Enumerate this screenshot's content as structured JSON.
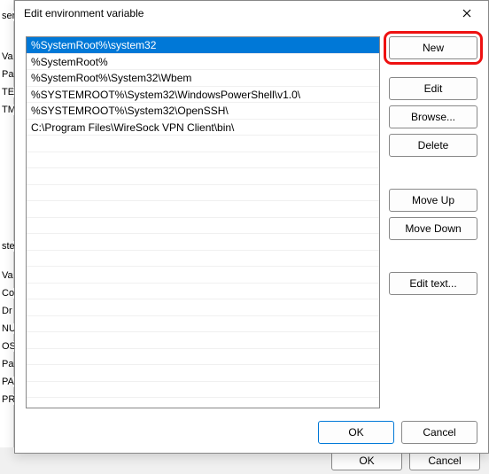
{
  "dialog": {
    "title": "Edit environment variable",
    "close_icon": "close-icon"
  },
  "paths": [
    "%SystemRoot%\\system32",
    "%SystemRoot%",
    "%SystemRoot%\\System32\\Wbem",
    "%SYSTEMROOT%\\System32\\WindowsPowerShell\\v1.0\\",
    "%SYSTEMROOT%\\System32\\OpenSSH\\",
    "C:\\Program Files\\WireSock VPN Client\\bin\\"
  ],
  "selected_index": 0,
  "buttons": {
    "new": "New",
    "edit": "Edit",
    "browse": "Browse...",
    "delete": "Delete",
    "move_up": "Move Up",
    "move_down": "Move Down",
    "edit_text": "Edit text..."
  },
  "footer": {
    "ok": "OK",
    "cancel": "Cancel"
  },
  "background": {
    "labels_left": [
      "ser",
      "Va",
      "Pa",
      "TE",
      "TM",
      "ste",
      "Va",
      "Co",
      "Dr",
      "NU",
      "OS",
      "Pa",
      "PA",
      "PR"
    ],
    "ok": "OK",
    "cancel": "Cancel"
  }
}
